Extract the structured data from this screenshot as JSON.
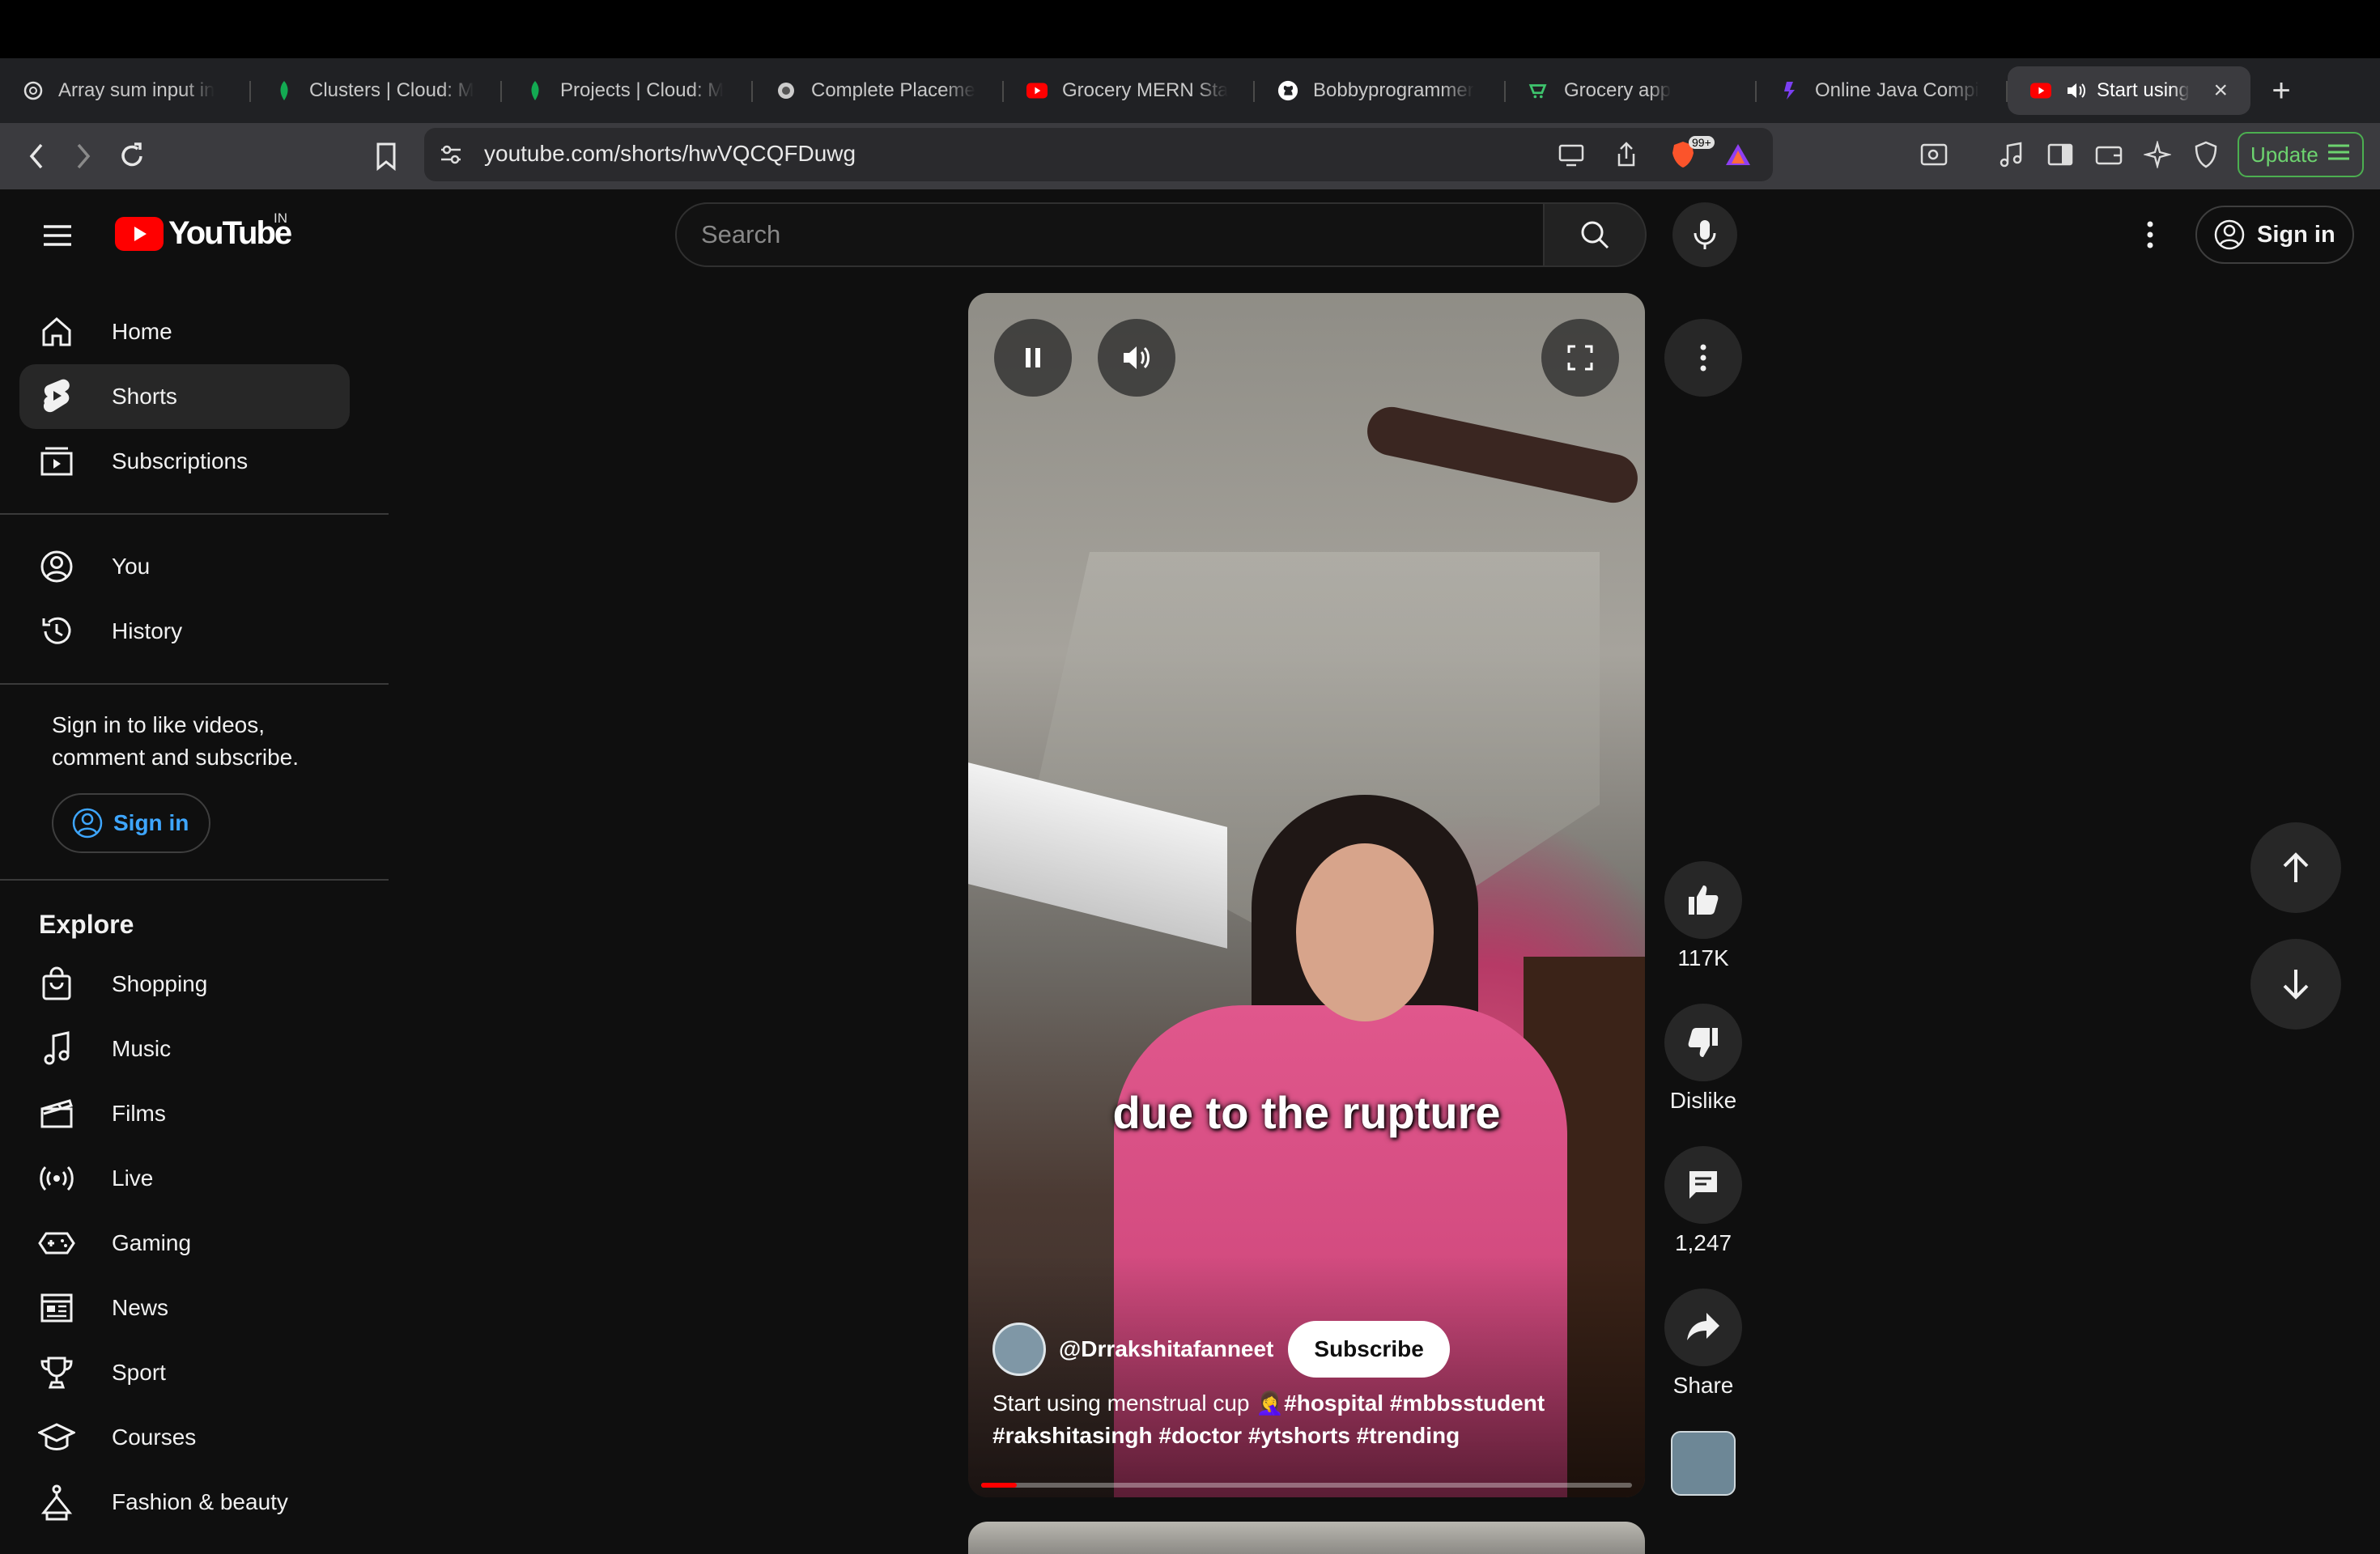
{
  "browser": {
    "tabs": [
      {
        "title": "Array sum input in",
        "icon": "openai-icon"
      },
      {
        "title": "Clusters | Cloud: M",
        "icon": "mongodb-leaf-icon"
      },
      {
        "title": "Projects | Cloud: M",
        "icon": "mongodb-leaf-icon"
      },
      {
        "title": "Complete Placeme",
        "icon": "site-icon"
      },
      {
        "title": "Grocery MERN Sta",
        "icon": "youtube-icon"
      },
      {
        "title": "Bobbyprogrammer",
        "icon": "github-icon"
      },
      {
        "title": "Grocery app",
        "icon": "app-icon"
      },
      {
        "title": "Online Java Compi",
        "icon": "compiler-icon"
      },
      {
        "title": "Start using",
        "icon": "youtube-icon",
        "active": true
      }
    ],
    "url": "youtube.com/shorts/hwVQCQFDuwg",
    "brave_badge": "99+",
    "update_label": "Update"
  },
  "youtube": {
    "logo_text": "YouTube",
    "country_code": "IN",
    "search_placeholder": "Search",
    "sign_in_label": "Sign in"
  },
  "sidebar": {
    "main": [
      {
        "label": "Home",
        "icon": "home-icon"
      },
      {
        "label": "Shorts",
        "icon": "shorts-icon",
        "active": true
      },
      {
        "label": "Subscriptions",
        "icon": "subscriptions-icon"
      }
    ],
    "you": [
      {
        "label": "You",
        "icon": "account-icon"
      },
      {
        "label": "History",
        "icon": "history-icon"
      }
    ],
    "signin_note": "Sign in to like videos, comment and subscribe.",
    "signin_button": "Sign in",
    "explore_title": "Explore",
    "explore": [
      {
        "label": "Shopping",
        "icon": "shopping-bag-icon"
      },
      {
        "label": "Music",
        "icon": "music-note-icon"
      },
      {
        "label": "Films",
        "icon": "film-clapper-icon"
      },
      {
        "label": "Live",
        "icon": "live-broadcast-icon"
      },
      {
        "label": "Gaming",
        "icon": "gamepad-icon"
      },
      {
        "label": "News",
        "icon": "newspaper-icon"
      },
      {
        "label": "Sport",
        "icon": "trophy-icon"
      },
      {
        "label": "Courses",
        "icon": "graduation-cap-icon"
      },
      {
        "label": "Fashion & beauty",
        "icon": "hanger-icon"
      }
    ]
  },
  "short": {
    "caption_overlay": "due to the rupture",
    "channel": "@Drrakshitafanneet",
    "subscribe_label": "Subscribe",
    "description_text": "Start using menstrual cup 🤦‍♀️",
    "description_tags_1": "#hospital #mbbsstudent",
    "description_tags_2": "#rakshitasingh #doctor #ytshorts #trending",
    "progress_fraction": 0.055,
    "likes": "117K",
    "dislike_label": "Dislike",
    "comments": "1,247",
    "share_label": "Share"
  }
}
